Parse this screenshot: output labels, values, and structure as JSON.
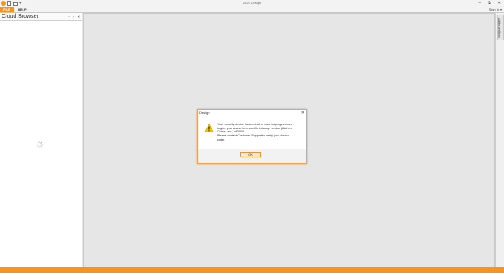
{
  "window": {
    "title": "2020 Design",
    "min_glyph": "–",
    "max_glyph": "⧉",
    "close_glyph": "✕",
    "quick_access_drop": "▾"
  },
  "ribbon": {
    "file_label": "FILE",
    "help_label": "HELP",
    "sign_in": "Sign in ▾"
  },
  "panel": {
    "title": "Cloud Browser",
    "pin_glyph": "▾",
    "float_glyph": "▫",
    "close_glyph": "✕"
  },
  "side_tab": {
    "label": "Attributes/Info"
  },
  "dialog": {
    "title": "Design",
    "close_glyph": "✕",
    "message_lines": [
      "Your security device has expired or was not programmed",
      "to give you access to a specific industry version (kitchen,",
      "Closet, etc.) of 2020.",
      "Please contact Customer Support to verify your device",
      "code."
    ],
    "ok_label": "OK",
    "icon": "warning-icon"
  },
  "colors": {
    "accent": "#f7941d",
    "warning_yellow": "#f5c400"
  }
}
